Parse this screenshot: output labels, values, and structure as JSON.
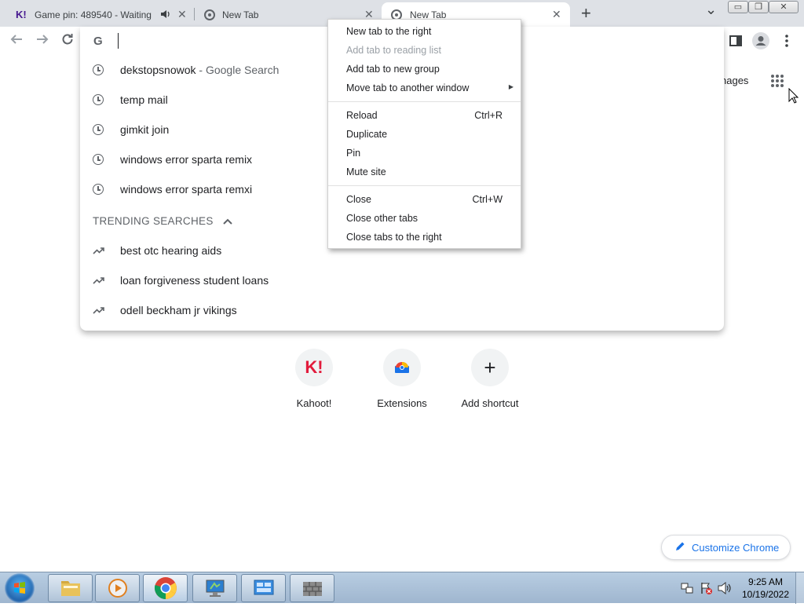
{
  "tabs": [
    {
      "title": "Game pin: 489540 - Waiting",
      "favicon_text": "K!",
      "audio_icon": "speaker-icon",
      "close": "✕"
    },
    {
      "title": "New Tab",
      "close": "✕"
    },
    {
      "title": "New Tab",
      "close": "✕",
      "active": true
    }
  ],
  "new_tab_symbol": "+",
  "tab_search_symbol": "⌄",
  "window_controls": {
    "minimize": "▭",
    "restore": "❐",
    "close": "✕"
  },
  "omnibox": {
    "value": "",
    "suggestions": [
      {
        "text": "dekstopsnowok",
        "suffix": " - Google Search",
        "icon": "clock-icon"
      },
      {
        "text": "temp mail",
        "icon": "clock-icon"
      },
      {
        "text": "gimkit join",
        "icon": "clock-icon"
      },
      {
        "text": "windows error sparta remix",
        "icon": "clock-icon"
      },
      {
        "text": "windows error sparta remxi",
        "icon": "clock-icon"
      }
    ],
    "trending_header": "TRENDING SEARCHES",
    "trending": [
      {
        "text": "best otc hearing aids",
        "icon": "trending-icon"
      },
      {
        "text": "loan forgiveness student loans",
        "icon": "trending-icon"
      },
      {
        "text": "odell beckham jr vikings",
        "icon": "trending-icon"
      }
    ]
  },
  "context_menu": {
    "group1": [
      {
        "label": "New tab to the right"
      },
      {
        "label": "Add tab to reading list",
        "disabled": true
      },
      {
        "label": "Add tab to new group"
      },
      {
        "label": "Move tab to another window",
        "submenu": "▶"
      }
    ],
    "group2": [
      {
        "label": "Reload",
        "accel": "Ctrl+R"
      },
      {
        "label": "Duplicate"
      },
      {
        "label": "Pin"
      },
      {
        "label": "Mute site"
      }
    ],
    "group3": [
      {
        "label": "Close",
        "accel": "Ctrl+W"
      },
      {
        "label": "Close other tabs"
      },
      {
        "label": "Close tabs to the right"
      }
    ]
  },
  "header_link": "nages",
  "shortcuts": [
    {
      "label": "Kahoot!",
      "icon_text": "K!"
    },
    {
      "label": "Extensions"
    },
    {
      "label": "Add shortcut",
      "icon_text": "+"
    }
  ],
  "customize_label": "Customize Chrome",
  "clock": {
    "time": "9:25 AM",
    "date": "10/19/2022"
  },
  "colors": {
    "kahoot": "#e21b3c",
    "accent_blue": "#1a73e8",
    "tab_strip": "#dee1e6"
  }
}
